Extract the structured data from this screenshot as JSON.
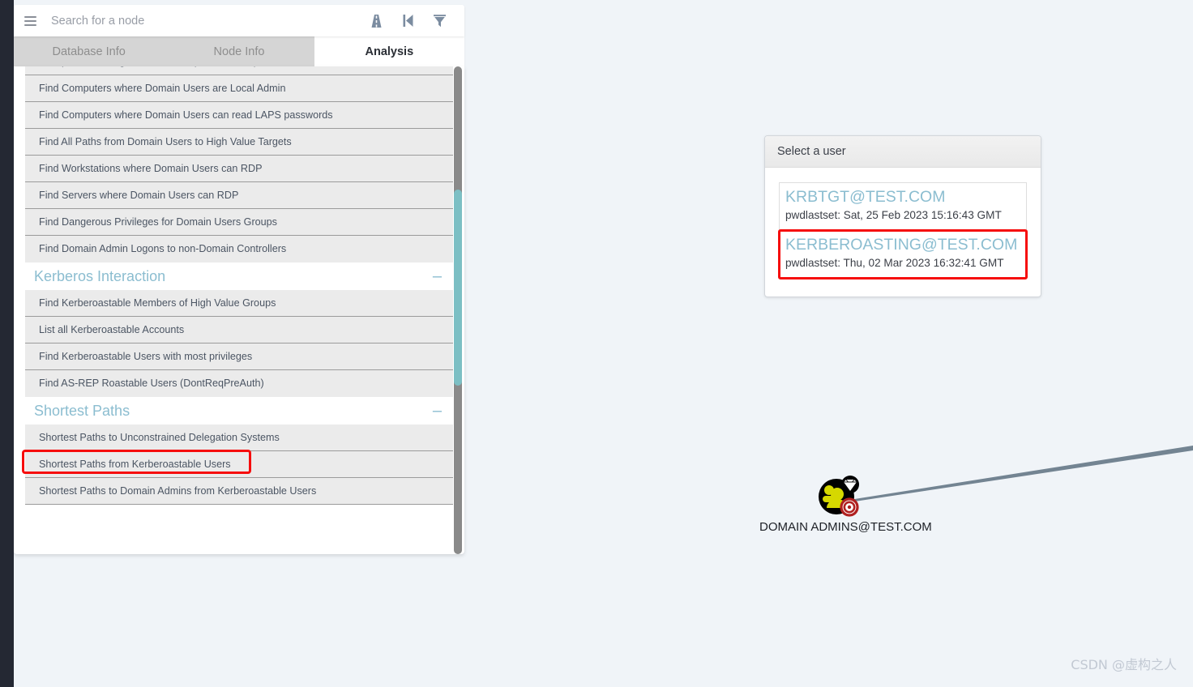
{
  "app": {
    "left_rail_color": "#242833",
    "canvas_background": "#f0f4f8",
    "accent_color": "#8bbdd0",
    "highlight_color": "#f60d0d"
  },
  "search": {
    "placeholder": "Search for a node",
    "value": ""
  },
  "toolbar": {
    "icons": [
      {
        "name": "pathfinding-icon",
        "title": "Pathfinding"
      },
      {
        "name": "skip-back-icon",
        "title": "Previous"
      },
      {
        "name": "filter-icon",
        "title": "Filter"
      }
    ]
  },
  "tabs": [
    {
      "label": "Database Info",
      "active": false
    },
    {
      "label": "Node Info",
      "active": false
    },
    {
      "label": "Analysis",
      "active": true
    }
  ],
  "analysis_list": {
    "clipped_top_row": "",
    "rows": [
      {
        "type": "item",
        "label": "Groups with Foreign Domain Group Membership"
      },
      {
        "type": "item",
        "label": "Find Computers where Domain Users are Local Admin"
      },
      {
        "type": "item",
        "label": "Find Computers where Domain Users can read LAPS passwords"
      },
      {
        "type": "item",
        "label": "Find All Paths from Domain Users to High Value Targets"
      },
      {
        "type": "item",
        "label": "Find Workstations where Domain Users can RDP"
      },
      {
        "type": "item",
        "label": "Find Servers where Domain Users can RDP"
      },
      {
        "type": "item",
        "label": "Find Dangerous Privileges for Domain Users Groups"
      },
      {
        "type": "item",
        "label": "Find Domain Admin Logons to non-Domain Controllers",
        "last_of_group": true
      },
      {
        "type": "group",
        "label": "Kerberos Interaction",
        "collapse": "–"
      },
      {
        "type": "item",
        "label": "Find Kerberoastable Members of High Value Groups"
      },
      {
        "type": "item",
        "label": "List all Kerberoastable Accounts"
      },
      {
        "type": "item",
        "label": "Find Kerberoastable Users with most privileges"
      },
      {
        "type": "item",
        "label": "Find AS-REP Roastable Users (DontReqPreAuth)",
        "last_of_group": true
      },
      {
        "type": "group",
        "label": "Shortest Paths",
        "collapse": "–"
      },
      {
        "type": "item",
        "label": "Shortest Paths to Unconstrained Delegation Systems"
      },
      {
        "type": "item",
        "label": "Shortest Paths from Kerberoastable Users",
        "highlighted": true
      },
      {
        "type": "item",
        "label": "Shortest Paths to Domain Admins from Kerberoastable Users"
      }
    ]
  },
  "select_user_dialog": {
    "title": "Select a user",
    "options": [
      {
        "upn": "KRBTGT@TEST.COM",
        "meta": "pwdlastset: Sat, 25 Feb 2023 15:16:43 GMT",
        "highlighted": false
      },
      {
        "upn": "KERBEROASTING@TEST.COM",
        "meta": "pwdlastset: Thu, 02 Mar 2023 16:32:41 GMT",
        "highlighted": true
      }
    ]
  },
  "graph": {
    "nodes": [
      {
        "name": "node-domain-admins",
        "label": "DOMAIN ADMINS@TEST.COM",
        "node_type": "group",
        "badges": [
          "high-value-diamond",
          "target-circle"
        ],
        "fill_color": "#d6d800",
        "outline_color": "#000000"
      }
    ],
    "edges": [
      {
        "from": "node-domain-admins",
        "to": "off-canvas-right"
      }
    ]
  },
  "watermark": {
    "text": "CSDN @虚构之人"
  }
}
